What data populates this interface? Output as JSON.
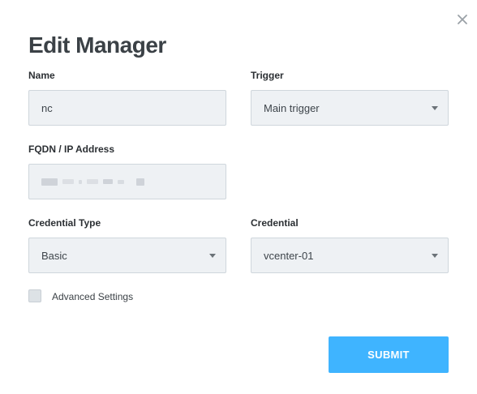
{
  "dialog": {
    "title": "Edit Manager",
    "close_icon": "close-icon"
  },
  "form": {
    "name": {
      "label": "Name",
      "value": "nc"
    },
    "trigger": {
      "label": "Trigger",
      "value": "Main trigger"
    },
    "fqdn": {
      "label": "FQDN / IP Address"
    },
    "credential_type": {
      "label": "Credential Type",
      "value": "Basic"
    },
    "credential": {
      "label": "Credential",
      "value": "vcenter-01"
    },
    "advanced": {
      "label": "Advanced Settings",
      "checked": false
    }
  },
  "actions": {
    "submit_label": "SUBMIT"
  },
  "colors": {
    "accent": "#3fb4ff",
    "field_bg": "#eef1f4",
    "title": "#3b4146"
  }
}
